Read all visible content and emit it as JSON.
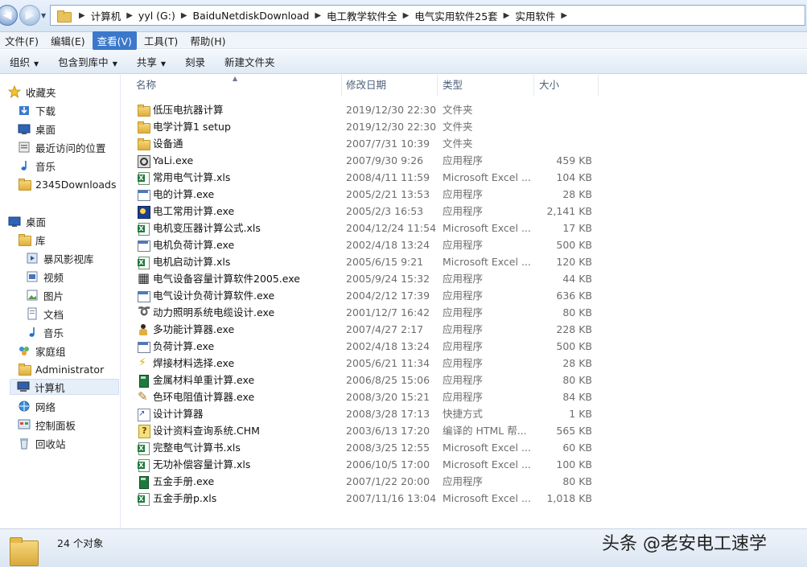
{
  "address": {
    "crumbs": [
      "计算机",
      "yyl (G:)",
      "BaiduNetdiskDownload",
      "电工教学软件全",
      "电气实用软件25套",
      "实用软件"
    ]
  },
  "menu": {
    "items": [
      "文件(F)",
      "编辑(E)",
      "查看(V)",
      "工具(T)",
      "帮助(H)"
    ],
    "active_index": 2
  },
  "toolbar": {
    "organize": "组织",
    "include_in_library": "包含到库中",
    "share": "共享",
    "burn": "刻录",
    "new_folder": "新建文件夹"
  },
  "nav": {
    "favorites": "收藏夹",
    "downloads": "下载",
    "desktop_fav": "桌面",
    "recent": "最近访问的位置",
    "music_fav": "音乐",
    "downloads2345": "2345Downloads",
    "desktop": "桌面",
    "libraries": "库",
    "storm": "暴风影视库",
    "video": "视频",
    "pictures": "图片",
    "documents": "文档",
    "music": "音乐",
    "homegroup": "家庭组",
    "admin": "Administrator",
    "computer": "计算机",
    "network": "网络",
    "control_panel": "控制面板",
    "recycle": "回收站"
  },
  "columns": {
    "name": "名称",
    "date": "修改日期",
    "type": "类型",
    "size": "大小"
  },
  "files": [
    {
      "name": "低压电抗器计算",
      "date": "2019/12/30 22:30",
      "type": "文件夹",
      "size": "",
      "icon": "folder-icon"
    },
    {
      "name": "电学计算1 setup",
      "date": "2019/12/30 22:30",
      "type": "文件夹",
      "size": "",
      "icon": "folder-icon"
    },
    {
      "name": "设备通",
      "date": "2007/7/31 10:39",
      "type": "文件夹",
      "size": "",
      "icon": "folder-icon"
    },
    {
      "name": "YaLi.exe",
      "date": "2007/9/30 9:26",
      "type": "应用程序",
      "size": "459 KB",
      "icon": "app-icon"
    },
    {
      "name": "常用电气计算.xls",
      "date": "2008/4/11 11:59",
      "type": "Microsoft Excel ...",
      "size": "104 KB",
      "icon": "excel-icon"
    },
    {
      "name": "电的计算.exe",
      "date": "2005/2/21 13:53",
      "type": "应用程序",
      "size": "28 KB",
      "icon": "exe-icon"
    },
    {
      "name": "电工常用计算.exe",
      "date": "2005/2/3 16:53",
      "type": "应用程序",
      "size": "2,141 KB",
      "icon": "app-icon"
    },
    {
      "name": "电机变压器计算公式.xls",
      "date": "2004/12/24 11:54",
      "type": "Microsoft Excel ...",
      "size": "17 KB",
      "icon": "excel-icon"
    },
    {
      "name": "电机负荷计算.exe",
      "date": "2002/4/18 13:24",
      "type": "应用程序",
      "size": "500 KB",
      "icon": "exe-icon"
    },
    {
      "name": "电机启动计算.xls",
      "date": "2005/6/15 9:21",
      "type": "Microsoft Excel ...",
      "size": "120 KB",
      "icon": "excel-icon"
    },
    {
      "name": "电气设备容量计算软件2005.exe",
      "date": "2005/9/24 15:32",
      "type": "应用程序",
      "size": "44 KB",
      "icon": "calc-icon"
    },
    {
      "name": "电气设计负荷计算软件.exe",
      "date": "2004/2/12 17:39",
      "type": "应用程序",
      "size": "636 KB",
      "icon": "exe-icon"
    },
    {
      "name": "动力照明系统电缆设计.exe",
      "date": "2001/12/7 16:42",
      "type": "应用程序",
      "size": "80 KB",
      "icon": "cable-icon"
    },
    {
      "name": "多功能计算器.exe",
      "date": "2007/4/27 2:17",
      "type": "应用程序",
      "size": "228 KB",
      "icon": "person-icon"
    },
    {
      "name": "负荷计算.exe",
      "date": "2002/4/18 13:24",
      "type": "应用程序",
      "size": "500 KB",
      "icon": "exe-icon"
    },
    {
      "name": "焊接材料选择.exe",
      "date": "2005/6/21 11:34",
      "type": "应用程序",
      "size": "28 KB",
      "icon": "bolt-icon"
    },
    {
      "name": "金属材料单重计算.exe",
      "date": "2006/8/25 15:06",
      "type": "应用程序",
      "size": "80 KB",
      "icon": "book-icon"
    },
    {
      "name": "色环电阻值计算器.exe",
      "date": "2008/3/20 15:21",
      "type": "应用程序",
      "size": "84 KB",
      "icon": "pen-icon"
    },
    {
      "name": "设计计算器",
      "date": "2008/3/28 17:13",
      "type": "快捷方式",
      "size": "1 KB",
      "icon": "shortcut-icon"
    },
    {
      "name": "设计资料查询系统.CHM",
      "date": "2003/6/13 17:20",
      "type": "编译的 HTML 帮...",
      "size": "565 KB",
      "icon": "help-icon"
    },
    {
      "name": "完整电气计算书.xls",
      "date": "2008/3/25 12:55",
      "type": "Microsoft Excel ...",
      "size": "60 KB",
      "icon": "excel-icon"
    },
    {
      "name": "无功补偿容量计算.xls",
      "date": "2006/10/5 17:00",
      "type": "Microsoft Excel ...",
      "size": "100 KB",
      "icon": "excel-icon"
    },
    {
      "name": "五金手册.exe",
      "date": "2007/1/22 20:00",
      "type": "应用程序",
      "size": "80 KB",
      "icon": "book-icon"
    },
    {
      "name": "五金手册p.xls",
      "date": "2007/11/16 13:04",
      "type": "Microsoft Excel ...",
      "size": "1,018 KB",
      "icon": "excel-icon"
    }
  ],
  "status": {
    "count": "24 个对象",
    "watermark": "头条 @老安电工速学"
  }
}
